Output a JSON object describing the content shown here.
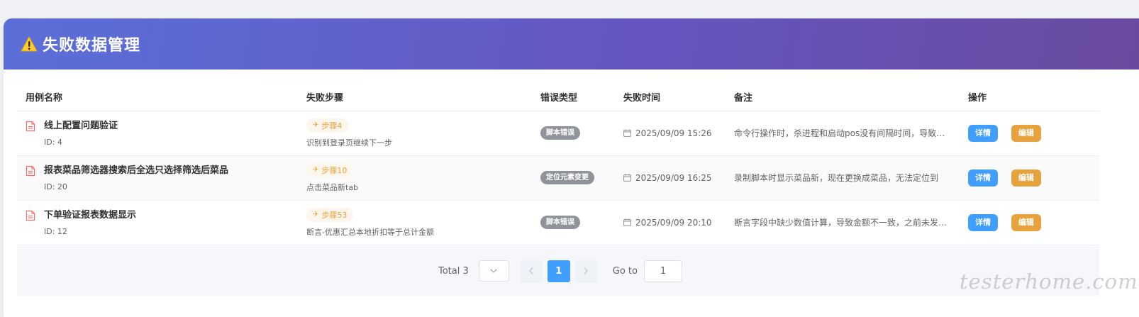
{
  "header": {
    "title": "失败数据管理",
    "icon": "warning-icon",
    "gradient": [
      "#5b6fd9",
      "#6a4a9e"
    ]
  },
  "table": {
    "columns": [
      "用例名称",
      "失败步骤",
      "错误类型",
      "失败时间",
      "备注",
      "操作"
    ],
    "rows": [
      {
        "name": "线上配置问题验证",
        "id": "ID: 4",
        "step": "步骤4",
        "step_desc": "识别到登录页继续下一步",
        "error_type": "脚本错误",
        "time": "2025/09/09 15:26",
        "note": "命令行操作时，杀进程和启动pos没有间隔时间，导致启动失败",
        "detail": "详情",
        "edit": "编辑"
      },
      {
        "name": "报表菜品筛选器搜索后全选只选择筛选后菜品",
        "id": "ID: 20",
        "step": "步骤10",
        "step_desc": "点击菜品新tab",
        "error_type": "定位元素变更",
        "time": "2025/09/09 16:25",
        "note": "录制脚本时显示菜品新，现在更换成菜品，无法定位到",
        "detail": "详情",
        "edit": "编辑"
      },
      {
        "name": "下单验证报表数据显示",
        "id": "ID: 12",
        "step": "步骤53",
        "step_desc": "断言-优惠汇总本地折扣等于总计金额",
        "error_type": "脚本错误",
        "time": "2025/09/09 20:10",
        "note": "断言字段中缺少数值计算，导致金额不一致，之前未发现该问题",
        "detail": "详情",
        "edit": "编辑"
      }
    ]
  },
  "pagination": {
    "total": "Total 3",
    "current_page": "1",
    "goto_label": "Go to",
    "goto_value": "1"
  },
  "watermark": "testerhome.com",
  "colors": {
    "primary": "#409eff",
    "warning": "#e6a23c",
    "info": "#909399"
  }
}
